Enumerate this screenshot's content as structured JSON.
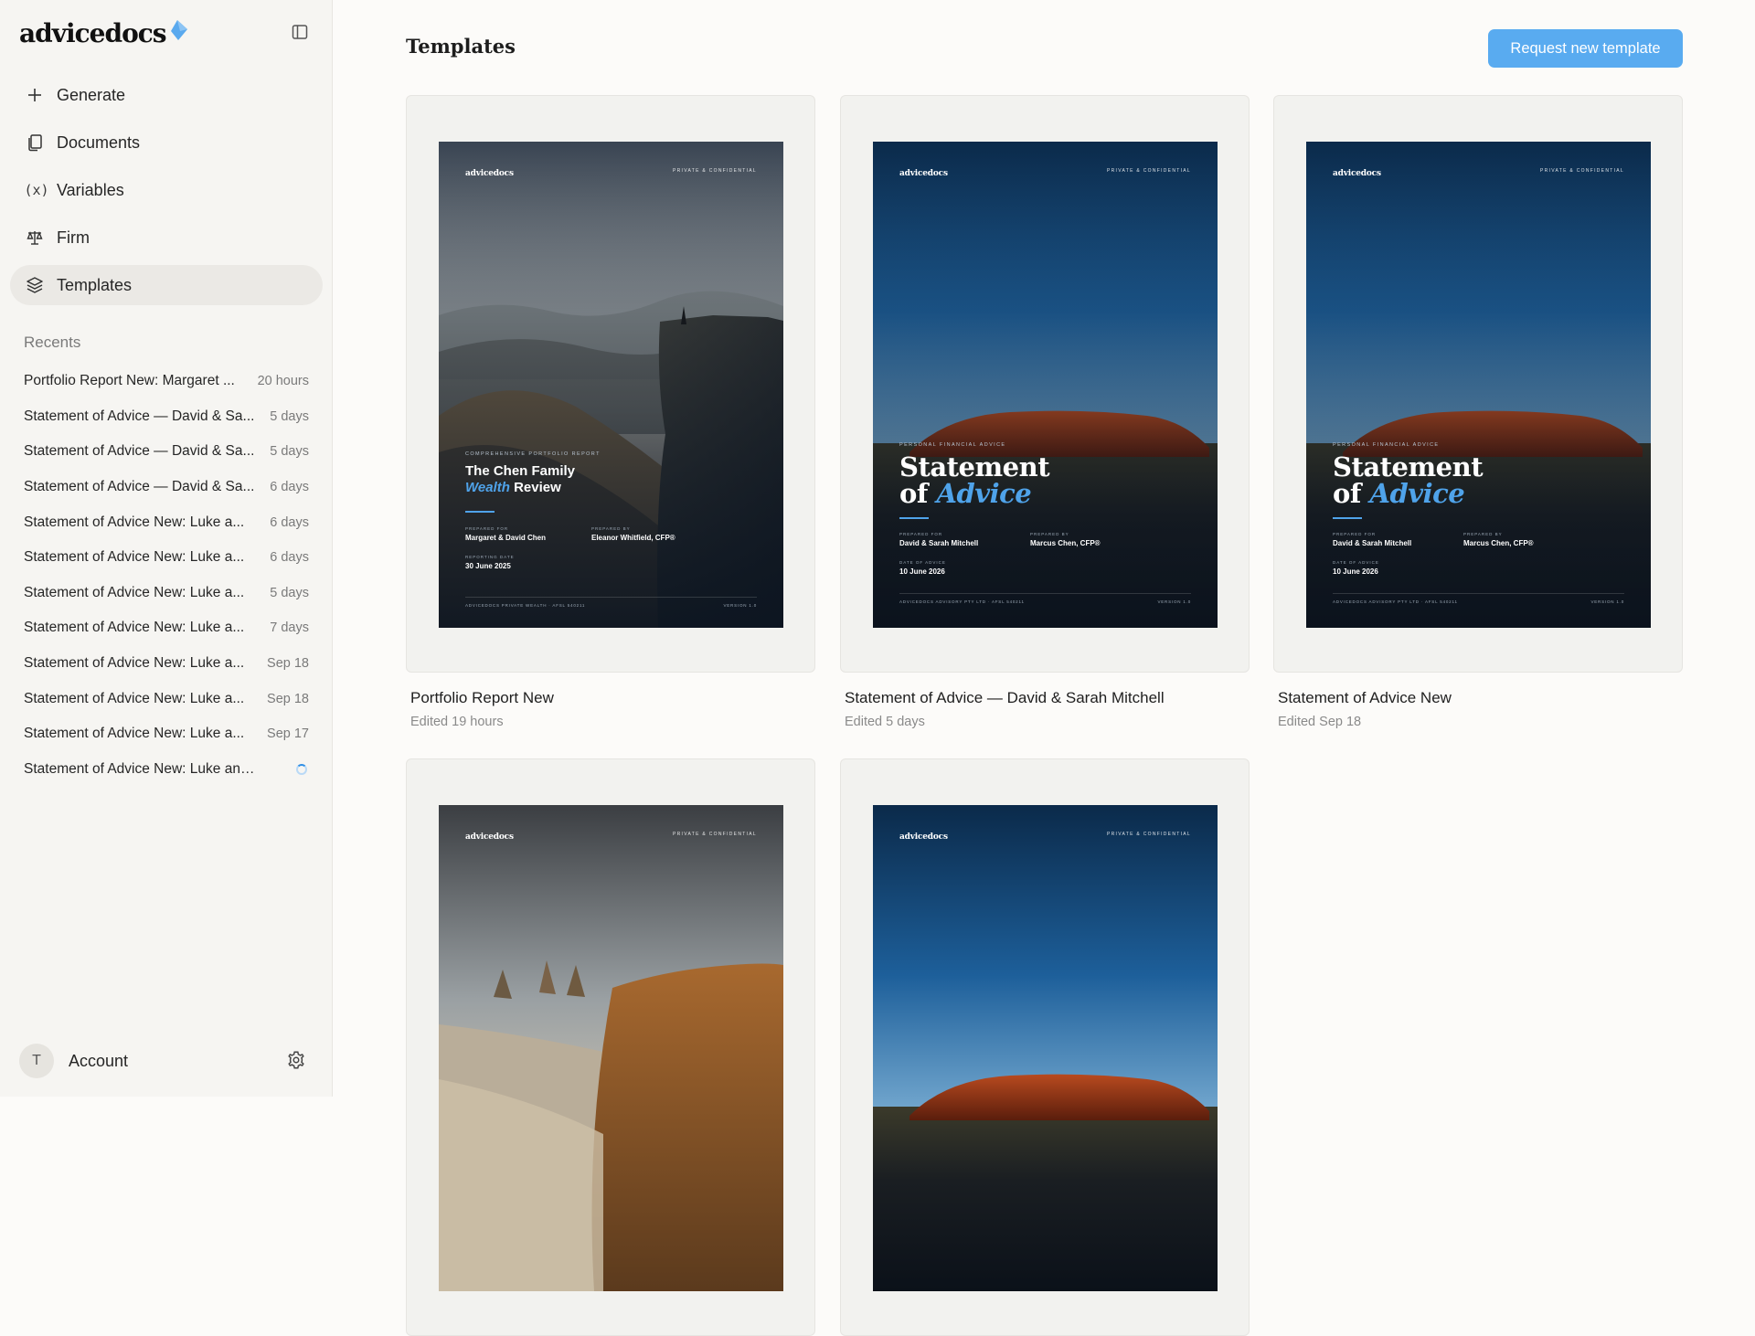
{
  "sidebar": {
    "logo_text": "advicedocs",
    "nav": [
      {
        "label": "Generate",
        "icon": "plus-icon"
      },
      {
        "label": "Documents",
        "icon": "documents-icon"
      },
      {
        "label": "Variables",
        "icon": "variables-icon"
      },
      {
        "label": "Firm",
        "icon": "scales-icon"
      },
      {
        "label": "Templates",
        "icon": "layers-icon",
        "active": true
      }
    ],
    "recents_title": "Recents",
    "recents": [
      {
        "title": "Portfolio Report New: Margaret ...",
        "time": "20 hours"
      },
      {
        "title": "Statement of Advice — David & Sa...",
        "time": "5 days"
      },
      {
        "title": "Statement of Advice — David & Sa...",
        "time": "5 days"
      },
      {
        "title": "Statement of Advice — David & Sa...",
        "time": "6 days"
      },
      {
        "title": "Statement of Advice New: Luke a...",
        "time": "6 days"
      },
      {
        "title": "Statement of Advice New: Luke a...",
        "time": "6 days"
      },
      {
        "title": "Statement of Advice New: Luke a...",
        "time": "5 days"
      },
      {
        "title": "Statement of Advice New: Luke a...",
        "time": "7 days"
      },
      {
        "title": "Statement of Advice New: Luke a...",
        "time": "Sep 18"
      },
      {
        "title": "Statement of Advice New: Luke a...",
        "time": "Sep 18"
      },
      {
        "title": "Statement of Advice New: Luke a...",
        "time": "Sep 17"
      },
      {
        "title": "Statement of Advice New: Luke and ...",
        "time": "",
        "loading": true
      }
    ],
    "account": {
      "initial": "T",
      "label": "Account"
    }
  },
  "main": {
    "title": "Templates",
    "request_button": "Request new template",
    "cards": [
      {
        "name": "Portfolio Report New",
        "edited": "Edited 19 hours",
        "cover": {
          "logo": "advicedocs",
          "confidential": "PRIVATE & CONFIDENTIAL",
          "eyebrow": "COMPREHENSIVE PORTFOLIO REPORT",
          "title_line1": "The Chen Family",
          "title_accent": "Wealth",
          "title_rest": "Review",
          "prepared_for_label": "PREPARED FOR",
          "prepared_for": "Margaret & David Chen",
          "prepared_by_label": "PREPARED BY",
          "prepared_by": "Eleanor Whitfield, CFP®",
          "date_label": "REPORTING DATE",
          "date": "30 June 2025",
          "footer_left": "ADVICEDOCS PRIVATE WEALTH · AFSL 540211",
          "footer_right": "VERSION 1.0"
        }
      },
      {
        "name": "Statement of Advice — David & Sarah Mitchell",
        "edited": "Edited 5 days",
        "cover": {
          "logo": "advicedocs",
          "confidential": "PRIVATE & CONFIDENTIAL",
          "eyebrow": "PERSONAL FINANCIAL ADVICE",
          "title_line1": "Statement",
          "title_of": "of",
          "title_accent": "Advice",
          "prepared_for_label": "PREPARED FOR",
          "prepared_for": "David & Sarah Mitchell",
          "prepared_by_label": "PREPARED BY",
          "prepared_by": "Marcus Chen, CFP®",
          "date_label": "DATE OF ADVICE",
          "date": "10 June 2026",
          "footer_left": "ADVICEDOCS ADVISORY PTY LTD · AFSL 540211",
          "footer_right": "VERSION 1.0"
        }
      },
      {
        "name": "Statement of Advice New",
        "edited": "Edited Sep 18",
        "cover": {
          "logo": "advicedocs",
          "confidential": "PRIVATE & CONFIDENTIAL",
          "eyebrow": "PERSONAL FINANCIAL ADVICE",
          "title_line1": "Statement",
          "title_of": "of",
          "title_accent": "Advice",
          "prepared_for_label": "PREPARED FOR",
          "prepared_for": "David & Sarah Mitchell",
          "prepared_by_label": "PREPARED BY",
          "prepared_by": "Marcus Chen, CFP®",
          "date_label": "DATE OF ADVICE",
          "date": "10 June 2026",
          "footer_left": "ADVICEDOCS ADVISORY PTY LTD · AFSL 540211",
          "footer_right": "VERSION 1.0"
        }
      },
      {
        "cover": {
          "logo": "advicedocs",
          "confidential": "PRIVATE & CONFIDENTIAL"
        }
      },
      {
        "cover": {
          "logo": "advicedocs",
          "confidential": "PRIVATE & CONFIDENTIAL"
        }
      }
    ]
  },
  "colors": {
    "accent": "#59abf0",
    "cover_accent": "#4fa3ea",
    "sidebar_bg": "#f6f5f2",
    "page_bg": "#fcfbf9"
  }
}
